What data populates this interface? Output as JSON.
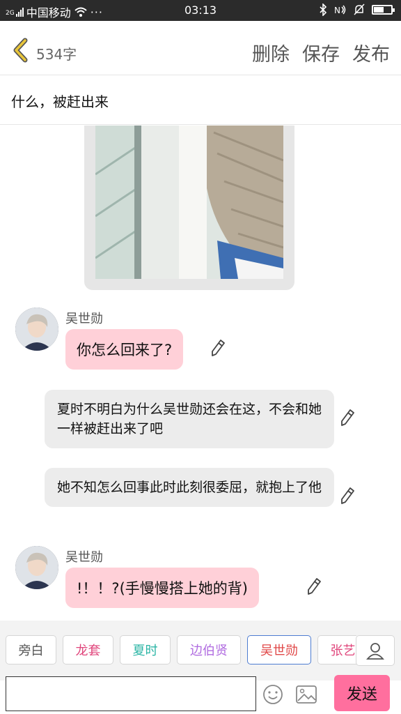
{
  "status": {
    "carrier": "中国移动",
    "signal_label": "2G",
    "time": "03:13"
  },
  "header": {
    "word_count": "534字",
    "delete_label": "删除",
    "save_label": "保存",
    "publish_label": "发布"
  },
  "story_title": "什么，被赶出来",
  "messages": [
    {
      "speaker": "吴世勋",
      "text": "你怎么回来了?"
    },
    {
      "speaker": "",
      "text": "夏时不明白为什么吴世勋还会在这，不会和她一样被赶出来了吧"
    },
    {
      "speaker": "",
      "text": "她不知怎么回事此时此刻很委屈，就抱上了他"
    },
    {
      "speaker": "吴世勋",
      "text": "!！！?(手慢慢搭上她的背)"
    }
  ],
  "roles": [
    {
      "label": "旁白",
      "color": "#555555"
    },
    {
      "label": "龙套",
      "color": "#e0457b"
    },
    {
      "label": "夏时",
      "color": "#2bb5a5"
    },
    {
      "label": "边伯贤",
      "color": "#b06be0"
    },
    {
      "label": "吴世勋",
      "color": "#e04848",
      "selected": true
    },
    {
      "label": "张艺",
      "color": "#e0457b"
    }
  ],
  "input": {
    "value": "",
    "send_label": "发送"
  },
  "colors": {
    "accent_pink": "#ff6f9e",
    "bubble_pink": "#ffd0d8",
    "bubble_gray": "#ececec",
    "back_arrow": "#e8c53a"
  }
}
